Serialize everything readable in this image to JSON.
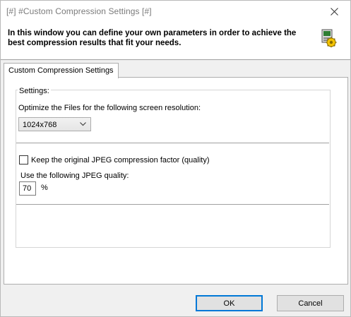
{
  "window": {
    "title": "[#] #Custom Compression Settings [#]",
    "close_glyph": "✕"
  },
  "header": {
    "description": "In this window you can define your own parameters in order to achieve the best compression results that fit your needs.",
    "icon": "settings-wizard-icon"
  },
  "tabs": [
    {
      "label": "Custom Compression Settings",
      "active": true
    }
  ],
  "settings": {
    "group_label": "Settings:",
    "resolution_label": "Optimize the Files for the following screen resolution:",
    "resolution_value": "1024x768",
    "keep_jpeg_label": "Keep the original JPEG compression factor (quality)",
    "keep_jpeg_checked": false,
    "quality_label": "Use the following JPEG quality:",
    "quality_value": "70",
    "quality_unit": "%"
  },
  "buttons": {
    "ok": "OK",
    "cancel": "Cancel"
  },
  "colors": {
    "focus_border": "#0078d7",
    "title_text": "#7a7a7a"
  }
}
